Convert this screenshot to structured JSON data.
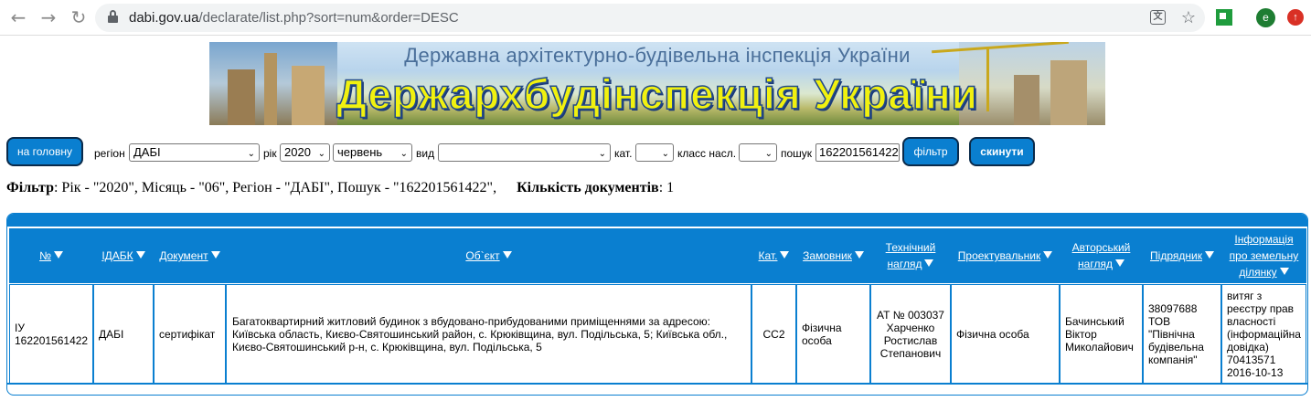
{
  "browser": {
    "url_host": "dabi.gov.ua",
    "url_path": "/declarate/list.php?sort=num&order=DESC",
    "avatar_letter": "e",
    "icons": [
      "back-icon",
      "forward-icon",
      "reload-icon",
      "lock-icon",
      "translate-icon",
      "star-icon",
      "extension-icon",
      "update-icon"
    ]
  },
  "banner": {
    "subtitle": "Державна архітектурно-будівельна інспекція України",
    "title": "Держархбудінспекція України"
  },
  "filters": {
    "home_button": "на головну",
    "region_label": "регіон",
    "region_value": "ДАБІ",
    "year_label": "рік",
    "year_value": "2020",
    "month_value": "червень",
    "type_label": "вид",
    "type_value": "",
    "category_label": "кат.",
    "category_value": "",
    "class_label": "класс насл.",
    "class_value": "",
    "search_label": "пошук",
    "search_value": "162201561422",
    "filter_button": "фільтр",
    "reset_button": "скинути"
  },
  "summary": {
    "filter_label": "Фільтр",
    "filter_text": ": Рік - \"2020\", Місяць - \"06\", Регіон - \"ДАБІ\", Пошук - \"162201561422\",",
    "count_label": "Кількість документів",
    "count_text": ": 1"
  },
  "table": {
    "headers": [
      {
        "label": "№",
        "sortable": true
      },
      {
        "label": "ІДАБК",
        "sortable": true
      },
      {
        "label": "Документ",
        "sortable": true
      },
      {
        "label": "Об`єкт",
        "sortable": true
      },
      {
        "label": "Кат.",
        "sortable": true
      },
      {
        "label": "Замовник",
        "sortable": true
      },
      {
        "label": "Технічний нагляд",
        "sortable": true
      },
      {
        "label": "Проектувальник",
        "sortable": true
      },
      {
        "label": "Авторський нагляд",
        "sortable": true
      },
      {
        "label": "Підрядник",
        "sortable": true
      },
      {
        "label": "Інформація про земельну ділянку",
        "sortable": true
      }
    ],
    "rows": [
      {
        "num": "ІУ 162201561422",
        "idabk": "ДАБІ",
        "document": "сертифікат",
        "object": "Багатоквартирний житловий будинок з вбудовано-прибудованими приміщеннями за адресою: Київська область, Києво-Святошинський район, с. Крюківщина, вул. Подільська, 5; Київська обл., Києво-Святошинський р-н, с. Крюківщина, вул. Подільська, 5",
        "category": "СС2",
        "customer": "Фізична особа",
        "tech_supervision": "АТ № 003037 Харченко Ростислав Степанович",
        "designer": "Фізична особа",
        "author_supervision": "Бачинський Віктор Миколайович",
        "contractor": "38097688 ТОВ \"Північна будівельна компанія\"",
        "land_info": "витяг з реєстру прав власності (інформаційна довідка) 70413571 2016-10-13"
      }
    ]
  },
  "colors": {
    "accent": "#0a7fd0",
    "button_border": "#0a2a4a",
    "banner_title": "#f1f10f"
  }
}
